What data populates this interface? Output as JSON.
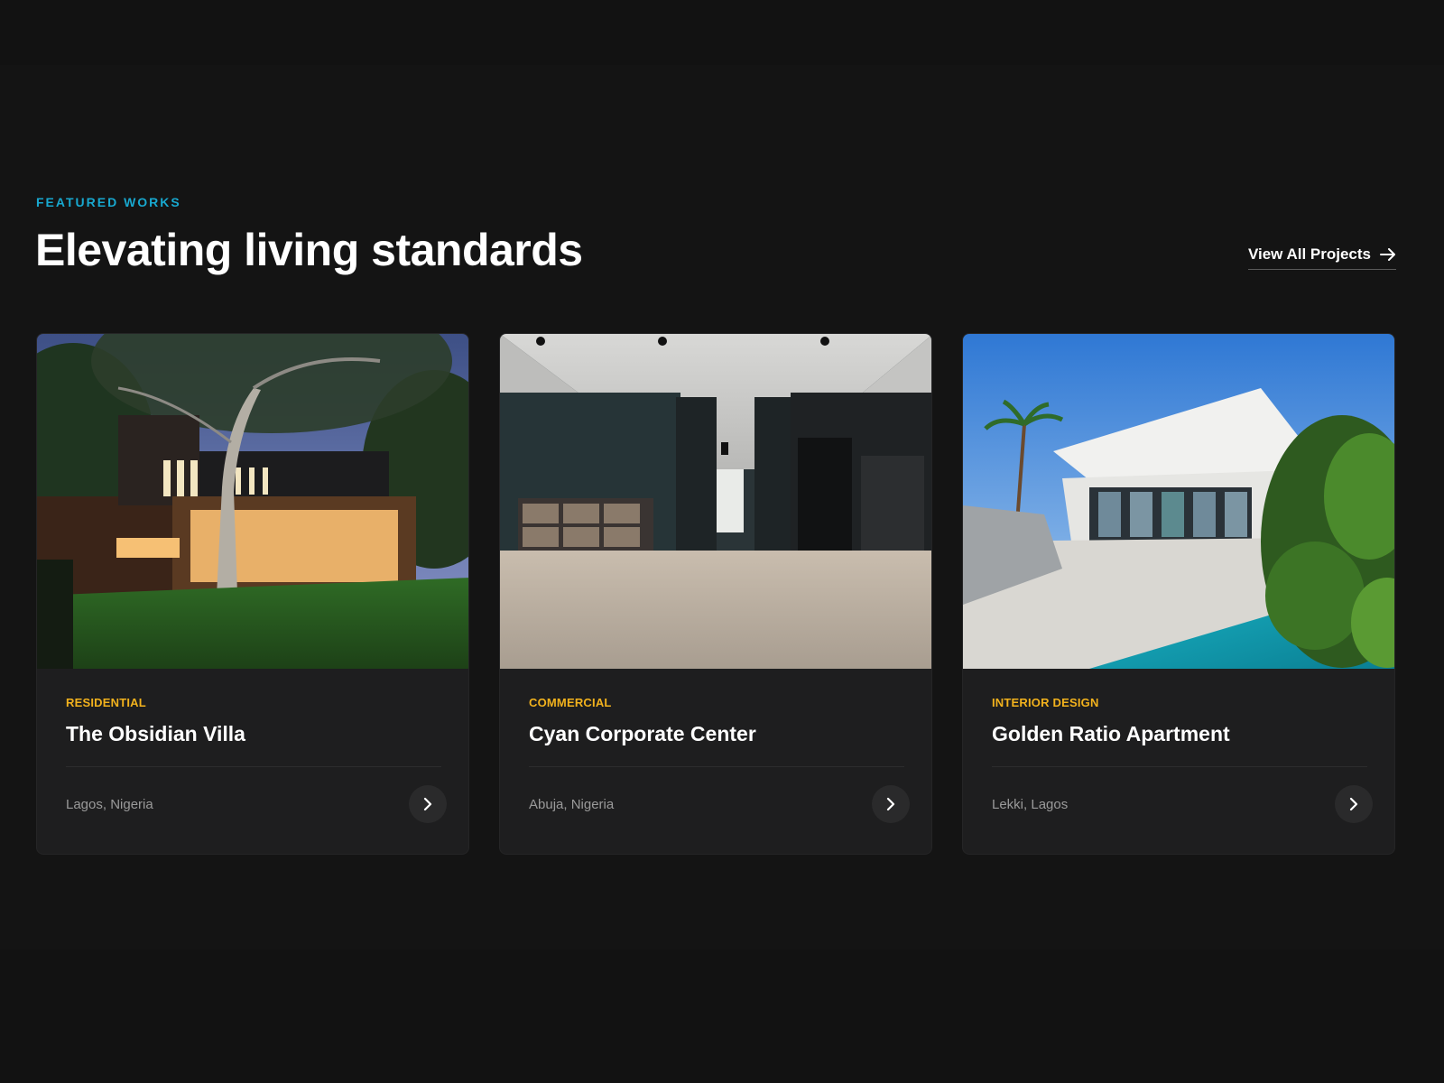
{
  "header": {
    "eyebrow": "FEATURED WORKS",
    "title": "Elevating living standards",
    "view_all_label": "View All Projects"
  },
  "colors": {
    "page_bg": "#121212",
    "card_bg": "#1e1e1f",
    "accent_cyan": "#18a8cf",
    "accent_gold": "#f2b21d",
    "text_primary": "#ffffff",
    "text_muted": "#9a9a9a"
  },
  "icons": {
    "view_all": "arrow-right-icon",
    "card_action": "chevron-right-icon"
  },
  "projects": [
    {
      "category": "RESIDENTIAL",
      "title": "The Obsidian Villa",
      "location": "Lagos, Nigeria",
      "image": "modern-house-dusk-photo"
    },
    {
      "category": "COMMERCIAL",
      "title": "Cyan Corporate Center",
      "location": "Abuja, Nigeria",
      "image": "office-interior-hallway-photo"
    },
    {
      "category": "INTERIOR DESIGN",
      "title": "Golden Ratio Apartment",
      "location": "Lekki, Lagos",
      "image": "white-villa-pool-photo"
    }
  ]
}
